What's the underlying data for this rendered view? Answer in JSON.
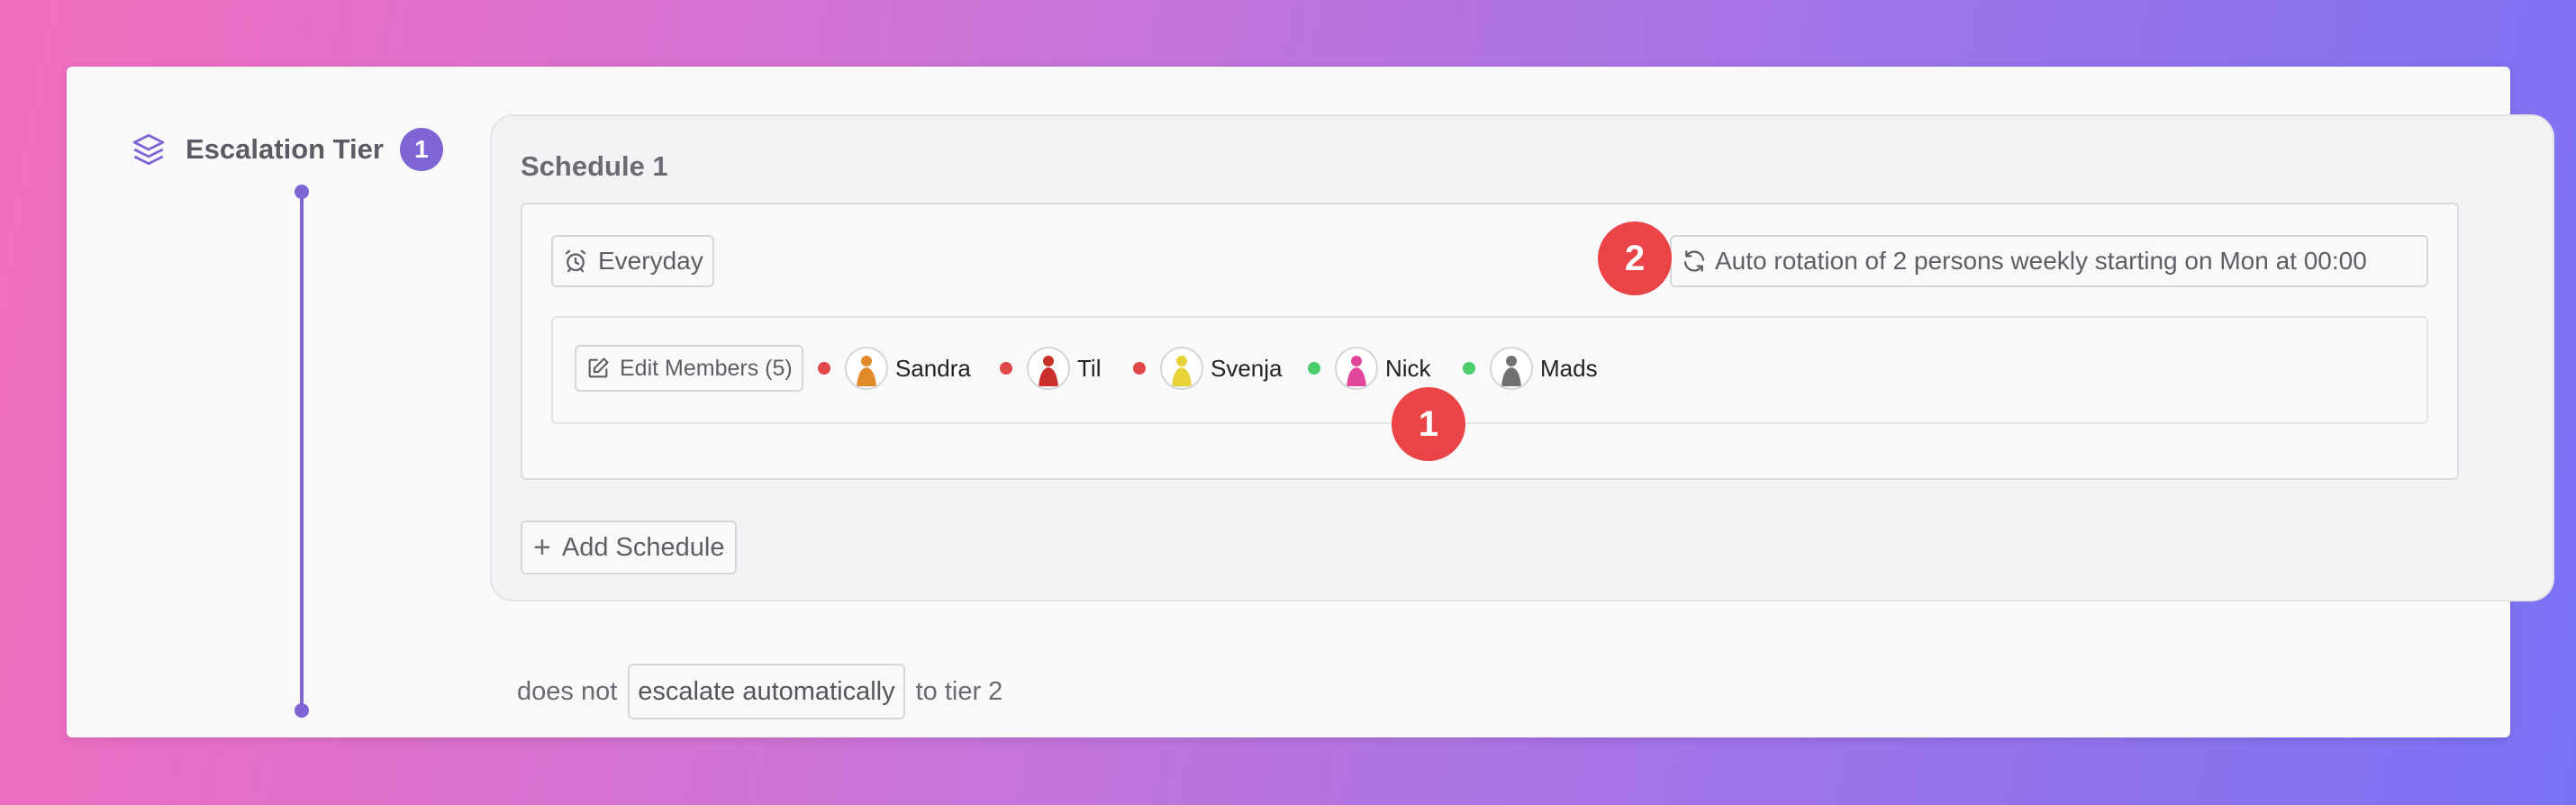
{
  "tier": {
    "title": "Escalation Tier",
    "number": "1"
  },
  "schedule": {
    "title": "Schedule 1",
    "everyday_label": "Everyday",
    "rotation_label": "Auto rotation of 2 persons weekly starting on Mon at 00:00",
    "edit_members_label": "Edit Members (5)",
    "members": [
      {
        "name": "Sandra",
        "status": "red",
        "avatar_color": "#e08a2c"
      },
      {
        "name": "Til",
        "status": "red",
        "avatar_color": "#c9302c"
      },
      {
        "name": "Svenja",
        "status": "red",
        "avatar_color": "#e8d23a"
      },
      {
        "name": "Nick",
        "status": "green",
        "avatar_color": "#e0479a"
      },
      {
        "name": "Mads",
        "status": "green",
        "avatar_color": "#707070"
      }
    ]
  },
  "add_schedule_label": "Add Schedule",
  "footer": {
    "prefix": "does not",
    "escalate_label": "escalate automatically",
    "suffix": "to tier 2"
  },
  "markers": {
    "one": "1",
    "two": "2"
  },
  "colors": {
    "accent": "#7f64d4",
    "status_red": "#e0474a",
    "status_green": "#4ccd6e",
    "marker": "#ea4446"
  }
}
